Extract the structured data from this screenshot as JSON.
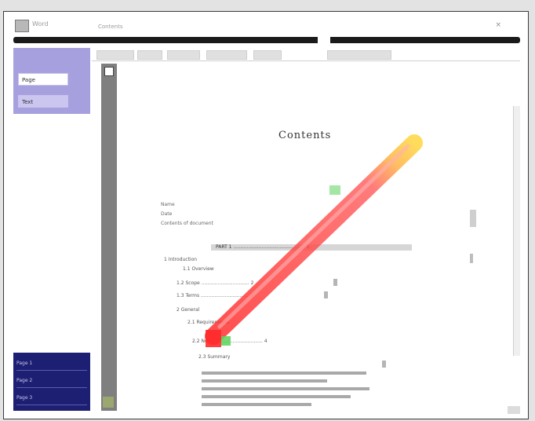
{
  "window": {
    "app_title": "Word",
    "doc_path": "Contents",
    "close_glyph": "×"
  },
  "sidebar": {
    "items": [
      {
        "label": "Page"
      },
      {
        "label": "Text"
      }
    ],
    "footer_items": [
      {
        "label": "Page 1"
      },
      {
        "label": "Page 2"
      },
      {
        "label": "Page 3"
      }
    ]
  },
  "document": {
    "heading": "Contents",
    "meta": [
      "Name",
      "Date",
      "Contents of document"
    ],
    "table_header": "PART 1 ................................................ 1",
    "toc": [
      {
        "text": "1 Introduction"
      },
      {
        "text": "1.1 Overview"
      },
      {
        "text": "1.2 Scope ................................ 2"
      },
      {
        "text": "1.3 Terms ................................ 3"
      },
      {
        "text": "2 General"
      },
      {
        "text": "2.1 Requirements"
      },
      {
        "text": "2.2 Notes ............................... 4"
      },
      {
        "text": "2.3 Summary"
      }
    ]
  },
  "colors": {
    "sidebar_head": "#a7a0de",
    "sidebar_foot": "#1d1f72",
    "pen_red": "#ff3b3b",
    "pen_yellow": "#ffd84a",
    "pen_green": "#5ad25a"
  },
  "icons": {
    "app": "document-icon",
    "close": "close-icon",
    "pen": "highlighter-pen-icon"
  }
}
